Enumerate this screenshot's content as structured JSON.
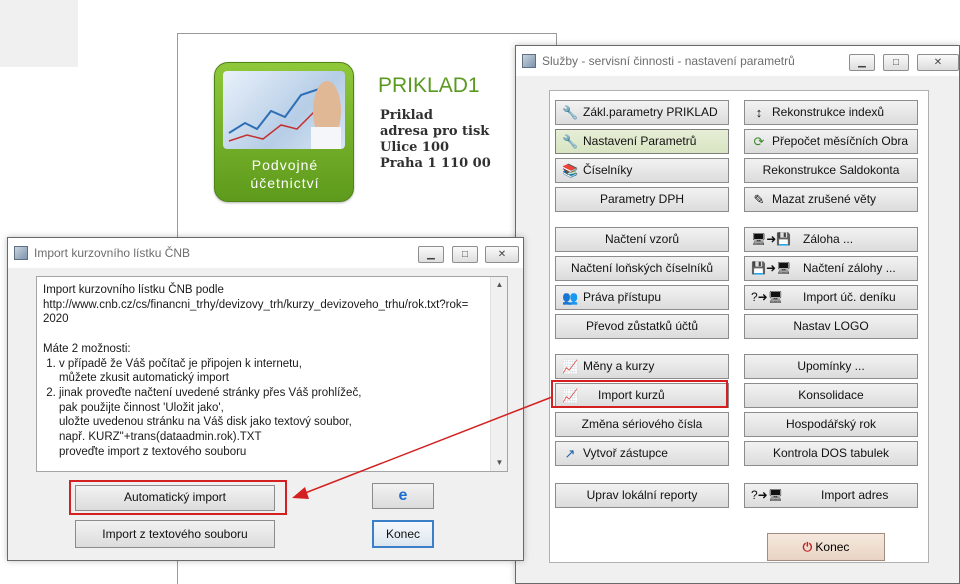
{
  "app": {
    "name": "PRIKLAD1",
    "company": "Priklad",
    "address_line1": "adresa pro tisk",
    "address_line2": "Ulice 100",
    "address_line3": "Praha 1  110 00",
    "logo_line1": "Podvojné",
    "logo_line2": "účetnictví"
  },
  "services_window": {
    "title": "Služby - servisní činnosti - nastavení parametrů",
    "minimize": "▁",
    "maximize": "□",
    "close": "✕",
    "buttons": {
      "zakl_parametry": "Zákl.parametry PRIKLAD",
      "nastaveni_parametru": "Nastavení Parametrů",
      "ciselniky": "Číselníky",
      "parametry_dph": "Parametry DPH",
      "nacteni_vzoru": "Načtení vzorů",
      "nacteni_loniskych": "Načtení loňských číselníků",
      "prava_pristupu": "Práva přístupu",
      "prevod_zustatku": "Převod zůstatků účtů",
      "meny_kurzy": "Měny a kurzy",
      "import_kurzu": "Import kurzů",
      "zmena_seriove": "Změna sériového čísla",
      "vytvor_zastupce": "Vytvoř zástupce",
      "uprav_reporty": "Uprav lokální reporty",
      "rekonstrukce_indexu": "Rekonstrukce indexů",
      "prepocet_mesicnich": "Přepočet měsíčních Obra",
      "rekonstrukce_saldokonta": "Rekonstrukce Saldokonta",
      "mazat_zrusene": "Mazat zrušené věty",
      "zaloha": "Záloha ...",
      "nacteni_zalohy": "Načtení zálohy ...",
      "import_uc_deniku": "Import úč. deníku",
      "nastav_logo": "Nastav LOGO",
      "upominky": "Upomínky ...",
      "konsolidace": "Konsolidace",
      "hospodarsky_rok": "Hospodářský rok",
      "kontrola_dos": "Kontrola DOS tabulek",
      "import_adres": "Import adres",
      "konec": "Konec"
    }
  },
  "import_window": {
    "title": "Import kurzovního lístku ČNB",
    "minimize": "▁",
    "maximize": "□",
    "close": "✕",
    "text": "Import kurzovního lístku ČNB podle\nhttp://www.cnb.cz/cs/financni_trhy/devizovy_trh/kurzy_devizoveho_trhu/rok.txt?rok=\n2020\n\nMáte 2 možnosti:\n 1. v případě že Váš počítač je připojen k internetu,\n     můžete zkusit automatický import\n 2. jinak proveďte načtení uvedené stránky přes Váš prohlížeč,\n     pak použijte činnost 'Uložit jako',\n     uložte uvedenou stránku na Váš disk jako textový soubor,\n     např. KURZ\"+trans(dataadmin.rok).TXT\n     proveďte import z textového souboru",
    "auto_import": "Automatický import",
    "import_text": "Import z textového souboru",
    "konec": "Konec"
  },
  "colors": {
    "highlight": "#d42020",
    "accent_green": "#5a9a20"
  }
}
